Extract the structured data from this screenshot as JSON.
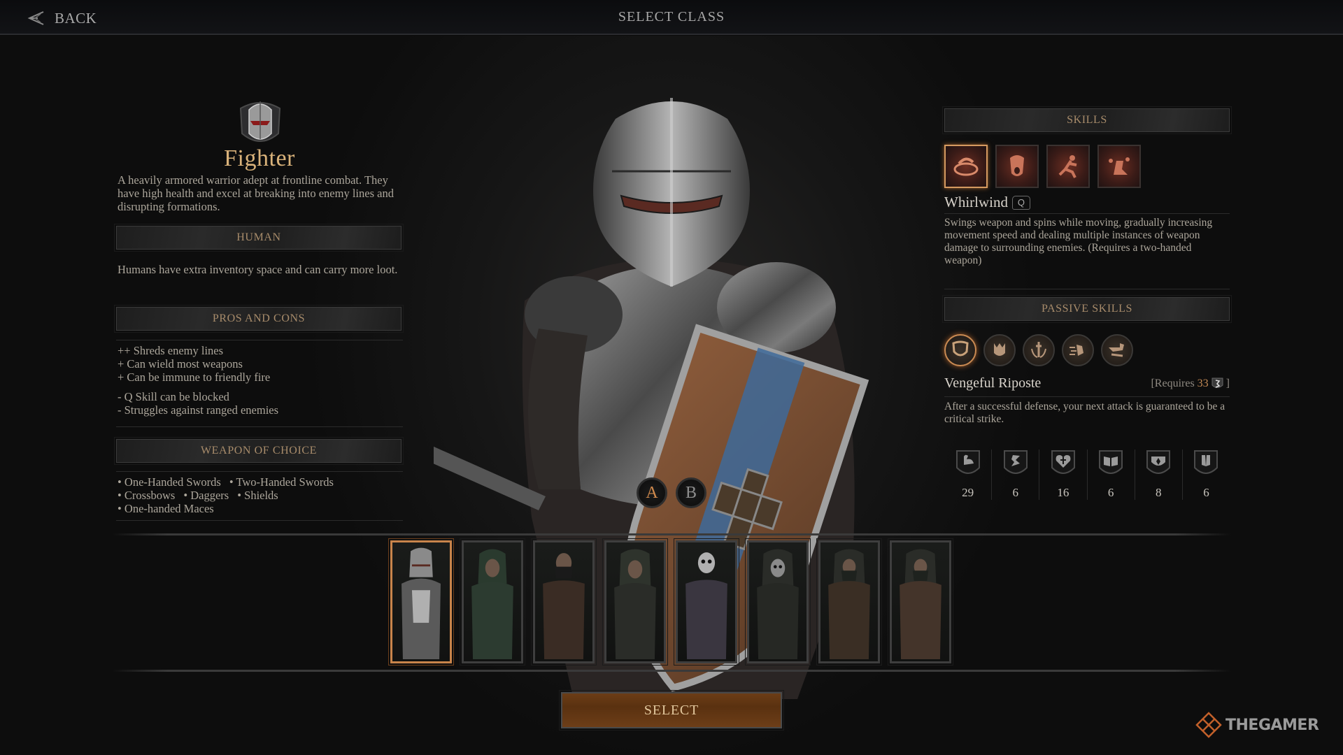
{
  "topbar": {
    "back_label": "BACK",
    "title": "SELECT CLASS"
  },
  "class": {
    "name": "Fighter",
    "emblem_icon": "knight-helmet-icon",
    "description": "A heavily armored warrior adept at frontline combat. They have high health and excel at breaking into enemy lines and disrupting formations."
  },
  "race": {
    "header": "HUMAN",
    "description": "Humans have extra inventory space and can carry more loot."
  },
  "pros_cons": {
    "header": "PROS AND CONS",
    "pros": [
      "++ Shreds enemy lines",
      "+ Can wield most weapons",
      "+ Can be immune to friendly fire"
    ],
    "cons": [
      "- Q Skill can be blocked",
      "- Struggles against ranged enemies"
    ]
  },
  "weapons": {
    "header": "WEAPON OF CHOICE",
    "rows": [
      [
        "• One-Handed Swords",
        "• Two-Handed Swords"
      ],
      [
        "• Crossbows",
        "• Daggers",
        "• Shields"
      ],
      [
        "• One-handed Maces"
      ]
    ]
  },
  "skills": {
    "header": "SKILLS",
    "icons": [
      {
        "name": "whirlwind-skill-icon",
        "selected": true
      },
      {
        "name": "war-cry-skill-icon",
        "selected": false
      },
      {
        "name": "sprint-skill-icon",
        "selected": false
      },
      {
        "name": "victory-strike-skill-icon",
        "selected": false
      }
    ],
    "selected_name": "Whirlwind",
    "selected_key": "Q",
    "selected_description": "Swings weapon and spins while moving, gradually increasing movement speed and dealing multiple instances of weapon damage to surrounding enemies. (Requires a two-handed weapon)"
  },
  "passive_skills": {
    "header": "PASSIVE SKILLS",
    "icons": [
      {
        "name": "shield-passive-icon",
        "selected": true
      },
      {
        "name": "beast-mask-passive-icon",
        "selected": false
      },
      {
        "name": "sword-laurel-passive-icon",
        "selected": false
      },
      {
        "name": "dash-foot-passive-icon",
        "selected": false
      },
      {
        "name": "kick-passive-icon",
        "selected": false
      }
    ],
    "selected_name": "Vengeful Riposte",
    "requires_prefix": "[Requires",
    "requires_value": "33",
    "requires_suffix": "]",
    "requires_icon": "agility-icon",
    "selected_description": "After a successful defense, your next attack is guaranteed to be a critical strike."
  },
  "stats": [
    {
      "icon": "strength-icon",
      "value": "29"
    },
    {
      "icon": "agility-icon",
      "value": "6"
    },
    {
      "icon": "will-icon",
      "value": "16"
    },
    {
      "icon": "knowledge-icon",
      "value": "6"
    },
    {
      "icon": "resourcefulness-icon",
      "value": "8"
    },
    {
      "icon": "faith-icon",
      "value": "6"
    }
  ],
  "skins": {
    "options": [
      "A",
      "B"
    ],
    "selected": "A"
  },
  "classes": [
    {
      "id": "fighter",
      "selected": true
    },
    {
      "id": "ranger",
      "selected": false
    },
    {
      "id": "rogue",
      "selected": false
    },
    {
      "id": "cleric",
      "selected": false
    },
    {
      "id": "skeleton-warrior",
      "selected": false
    },
    {
      "id": "skeleton-mage",
      "selected": false
    },
    {
      "id": "barbarian",
      "selected": false
    },
    {
      "id": "bard",
      "selected": false
    }
  ],
  "select_button": "SELECT",
  "watermark": "THEGAMER",
  "colors": {
    "accent_gold": "#d9b27a",
    "accent_orange": "#c8844b",
    "section_header_text": "#a88c6b",
    "body_text": "#aca69b",
    "skill_red": "#6b2e22",
    "select_button": "#5a3110"
  }
}
